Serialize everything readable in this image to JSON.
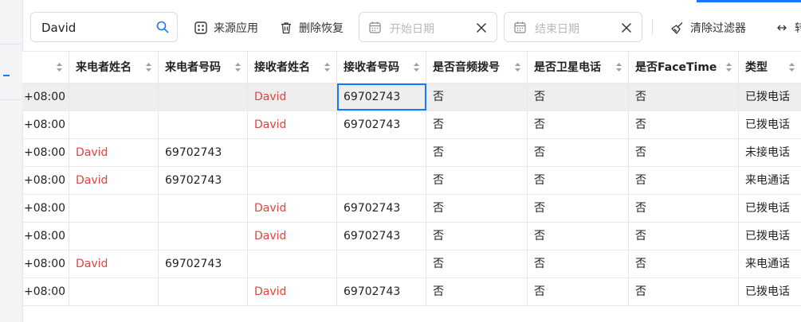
{
  "search": {
    "value": "David"
  },
  "toolbar": {
    "source_app_label": "来源应用",
    "restore_deleted_label": "删除恢复",
    "start_date_placeholder": "开始日期",
    "end_date_placeholder": "结束日期",
    "clear_filters_label": "清除过滤器",
    "more_label": "转"
  },
  "table": {
    "columns": [
      "",
      "来电者姓名",
      "来电者号码",
      "接收者姓名",
      "接收者号码",
      "是否音频拨号",
      "是否卫星电话",
      "是否FaceTime",
      "类型"
    ],
    "rows": [
      [
        "+08:00",
        "",
        "",
        "David",
        "69702743",
        "否",
        "否",
        "否",
        "已拨电话"
      ],
      [
        "+08:00",
        "",
        "",
        "David",
        "69702743",
        "否",
        "否",
        "否",
        "已拨电话"
      ],
      [
        "+08:00",
        "David",
        "69702743",
        "",
        "",
        "否",
        "否",
        "否",
        "未接电话"
      ],
      [
        "+08:00",
        "David",
        "69702743",
        "",
        "",
        "否",
        "否",
        "否",
        "来电通话"
      ],
      [
        "+08:00",
        "",
        "",
        "David",
        "69702743",
        "否",
        "否",
        "否",
        "已拨电话"
      ],
      [
        "+08:00",
        "",
        "",
        "David",
        "69702743",
        "否",
        "否",
        "否",
        "已拨电话"
      ],
      [
        "+08:00",
        "David",
        "69702743",
        "",
        "",
        "否",
        "否",
        "否",
        "来电通话"
      ],
      [
        "+08:00",
        "",
        "",
        "David",
        "69702743",
        "否",
        "否",
        "否",
        "已拨电话"
      ]
    ]
  },
  "colors": {
    "accent": "#1677ff",
    "name_highlight": "#e0443d",
    "selected_row": "#eeeeee"
  }
}
